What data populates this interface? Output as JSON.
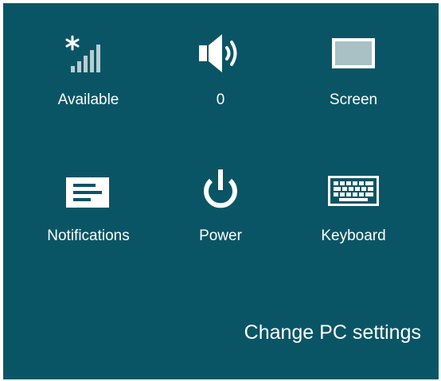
{
  "settings_tiles": [
    {
      "id": "network",
      "icon": "wifi-signal-icon",
      "label": "Available"
    },
    {
      "id": "volume",
      "icon": "speaker-icon",
      "label": "0"
    },
    {
      "id": "screen",
      "icon": "screen-icon",
      "label": "Screen"
    },
    {
      "id": "notifications",
      "icon": "notifications-icon",
      "label": "Notifications"
    },
    {
      "id": "power",
      "icon": "power-icon",
      "label": "Power"
    },
    {
      "id": "keyboard",
      "icon": "keyboard-icon",
      "label": "Keyboard"
    }
  ],
  "footer": {
    "change_settings_label": "Change PC settings"
  },
  "colors": {
    "background": "#0a5565",
    "foreground": "#ffffff",
    "dim_icon": "#b8cdd2"
  }
}
